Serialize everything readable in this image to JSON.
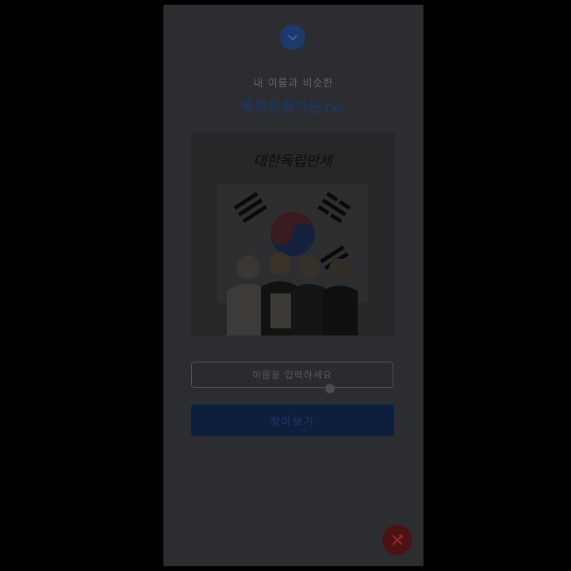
{
  "header": {
    "badge_icon": "chevron-down-icon",
    "subtitle": "내 이름과 비슷한",
    "title": "독립운동가는?",
    "title_suffix": "KR"
  },
  "illustration": {
    "calligraphy": "대한독립만세",
    "description_icon": "korean-flag-illustration"
  },
  "form": {
    "name_placeholder": "이름을 입력하세요",
    "name_value": "",
    "search_label": "찾아보기"
  },
  "fab": {
    "icon": "tools-icon"
  },
  "colors": {
    "accent": "#1e3a6d",
    "fab": "#4c1213",
    "overlay": "#000000"
  }
}
